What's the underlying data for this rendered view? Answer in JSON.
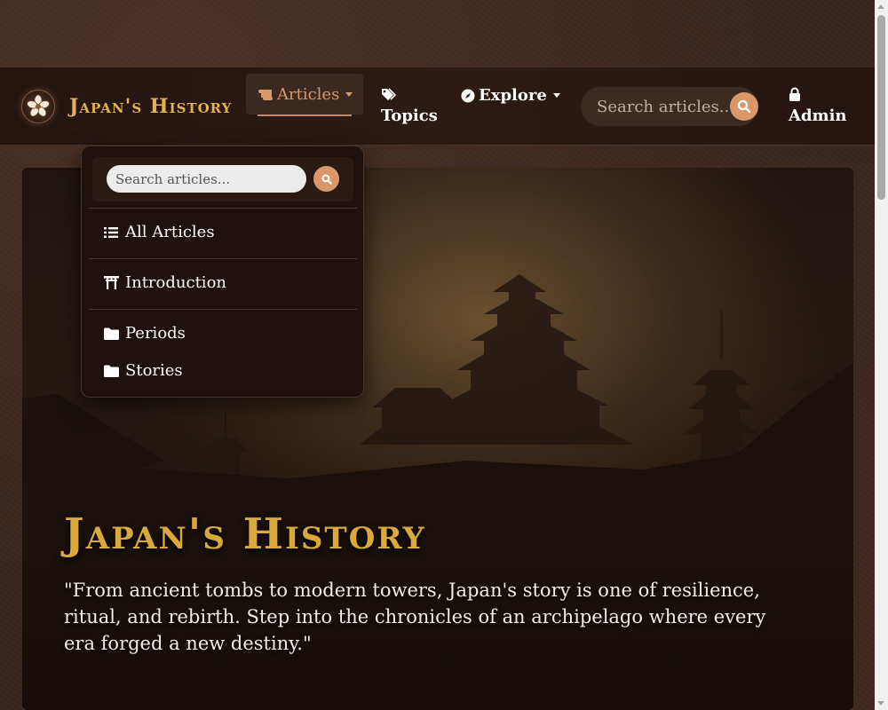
{
  "brand": {
    "title": "Japan's History"
  },
  "nav": {
    "articles_label": "Articles",
    "topics_label": "Topics",
    "explore_label": "Explore",
    "admin_label": "Admin",
    "search_placeholder": "Search articles..."
  },
  "dropdown": {
    "search_placeholder": "Search articles...",
    "items": [
      {
        "label": "All Articles",
        "icon": "list-icon"
      },
      {
        "label": "Introduction",
        "icon": "torii-gate-icon"
      },
      {
        "label": "Periods",
        "icon": "folder-icon"
      },
      {
        "label": "Stories",
        "icon": "folder-icon"
      }
    ]
  },
  "hero": {
    "title": "Japan's History",
    "quote": "\"From ancient tombs to modern towers, Japan's story is one of resilience, ritual, and rebirth. Step into the chronicles of an archipelago where every era forged a new destiny.\""
  },
  "colors": {
    "accent_gold": "#d9a93c",
    "accent_copper": "#d9976a",
    "nav_bg": "#2a1812",
    "page_bg": "#3a2620"
  }
}
